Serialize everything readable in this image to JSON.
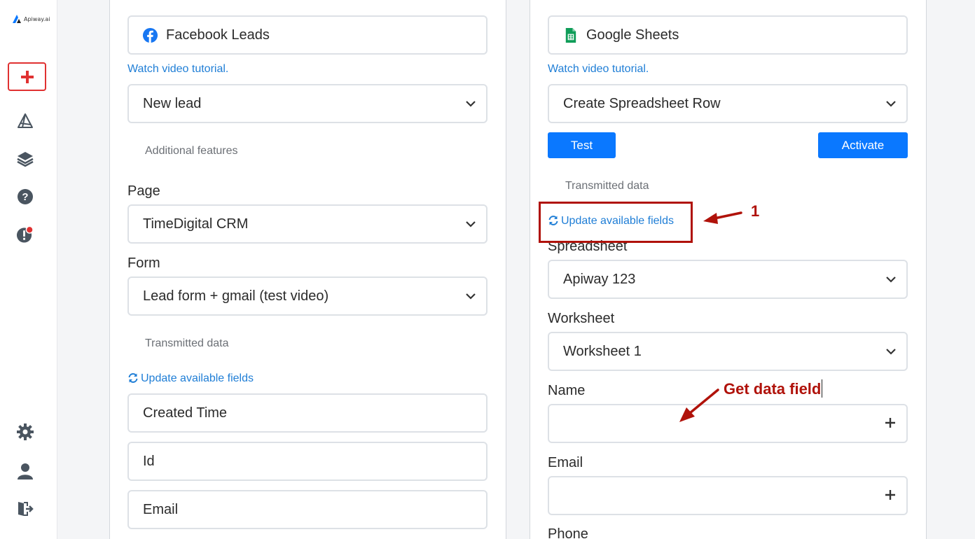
{
  "app": {
    "logo_text": "Apiway.ai"
  },
  "sidebar": {
    "icons": [
      "add-icon",
      "routes-icon",
      "layers-icon",
      "help-icon",
      "alert-icon",
      "gear-icon",
      "user-icon",
      "logout-icon"
    ]
  },
  "left": {
    "service": "Facebook Leads",
    "tutorial_link": "Watch video tutorial.",
    "trigger": "New lead",
    "additional": "Additional features",
    "page_label": "Page",
    "page_value": "TimeDigital CRM",
    "form_label": "Form",
    "form_value": "Lead form + gmail (test video)",
    "transmitted": "Transmitted data",
    "update_link": "Update available fields",
    "fields": [
      "Created Time",
      "Id",
      "Email"
    ]
  },
  "right": {
    "service": "Google Sheets",
    "tutorial_link": "Watch video tutorial.",
    "action": "Create Spreadsheet Row",
    "test_label": "Test",
    "activate_label": "Activate",
    "transmitted": "Transmitted data",
    "update_link": "Update available fields",
    "spreadsheet_label": "Spreadsheet",
    "spreadsheet_value": "Apiway 123",
    "worksheet_label": "Worksheet",
    "worksheet_value": "Worksheet 1",
    "name_label": "Name",
    "name_value": "",
    "email_label": "Email",
    "email_value": "",
    "phone_label": "Phone"
  },
  "annotations": {
    "step_number": "1",
    "get_data_note": "Get data field"
  },
  "colors": {
    "accent": "#0a78ff",
    "link": "#1f7ed6",
    "annotation": "#b0120a",
    "add_button": "#e03131"
  }
}
